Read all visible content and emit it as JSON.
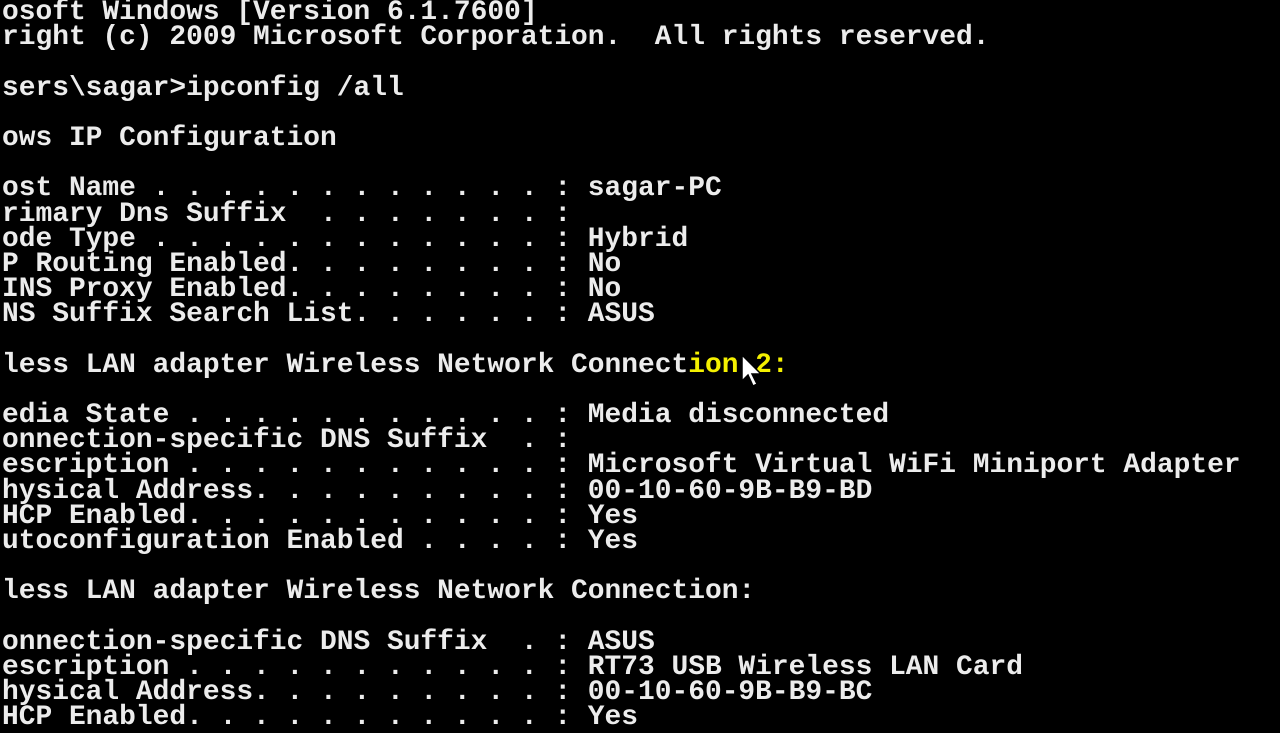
{
  "window": {
    "type": "command-prompt"
  },
  "colors": {
    "background": "#000000",
    "text": "#ececec",
    "highlight": "#f4f000"
  },
  "lines": [
    "osoft Windows [Version 6.1.7600]",
    "right (c) 2009 Microsoft Corporation.  All rights reserved.",
    "",
    "sers\\sagar>ipconfig /all",
    "",
    "ows IP Configuration",
    "",
    "ost Name . . . . . . . . . . . . : sagar-PC",
    "rimary Dns Suffix  . . . . . . . :",
    "ode Type . . . . . . . . . . . . : Hybrid",
    "P Routing Enabled. . . . . . . . : No",
    "INS Proxy Enabled. . . . . . . . : No",
    "NS Suffix Search List. . . . . . : ASUS",
    "",
    "",
    "",
    "edia State . . . . . . . . . . . : Media disconnected",
    "onnection-specific DNS Suffix  . :",
    "escription . . . . . . . . . . . : Microsoft Virtual WiFi Miniport Adapter",
    "hysical Address. . . . . . . . . : 00-10-60-9B-B9-BD",
    "HCP Enabled. . . . . . . . . . . : Yes",
    "utoconfiguration Enabled . . . . : Yes",
    "",
    "less LAN adapter Wireless Network Connection:",
    "",
    "onnection-specific DNS Suffix  . : ASUS",
    "escription . . . . . . . . . . . : RT73 USB Wireless LAN Card",
    "hysical Address. . . . . . . . . : 00-10-60-9B-B9-BC",
    "HCP Enabled. . . . . . . . . . . : Yes"
  ],
  "adapter2_header": {
    "plain": "less LAN adapter Wireless Network Connect",
    "highlighted": "ion 2:"
  },
  "cursor_icon": "arrow-pointer"
}
